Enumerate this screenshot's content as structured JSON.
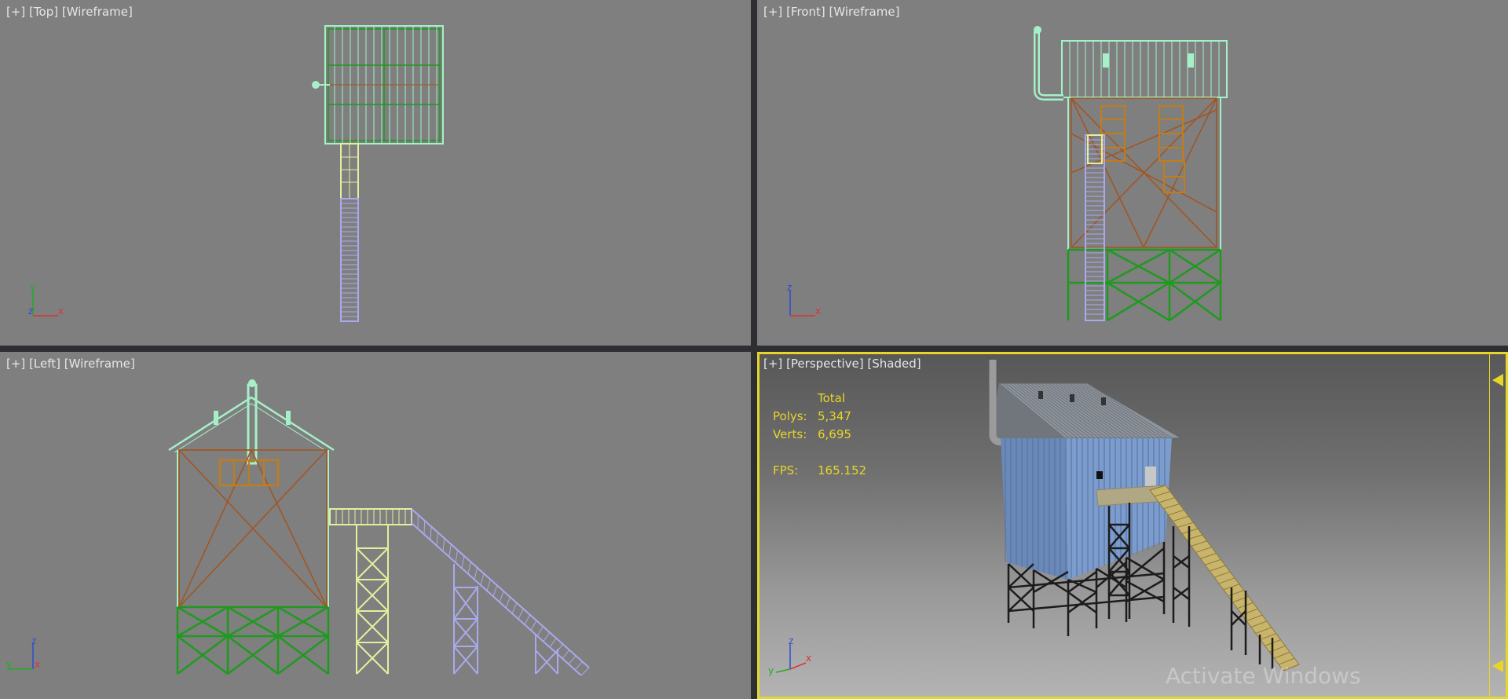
{
  "viewports": {
    "top": {
      "plus": "[+]",
      "view": "[Top]",
      "mode": "[Wireframe]"
    },
    "front": {
      "plus": "[+]",
      "view": "[Front]",
      "mode": "[Wireframe]"
    },
    "left": {
      "plus": "[+]",
      "view": "[Left]",
      "mode": "[Wireframe]"
    },
    "perspective": {
      "plus": "[+]",
      "view": "[Perspective]",
      "mode": "[Shaded]"
    }
  },
  "stats": {
    "header": "Total",
    "polys_label": "Polys:",
    "polys_value": "5,347",
    "verts_label": "Verts:",
    "verts_value": "6,695",
    "fps_label": "FPS:",
    "fps_value": "165.152"
  },
  "axes": {
    "top": {
      "up": "y",
      "left": "z",
      "right": "x"
    },
    "front": {
      "up": "z",
      "left": "y",
      "right": "x"
    },
    "left": {
      "up": "z",
      "left": "y",
      "right": "x"
    },
    "persp": {
      "up": "z",
      "left": "y",
      "right": "x"
    }
  },
  "watermark": "Activate Windows",
  "colors": {
    "active_border": "#e7d52a",
    "viewport_bg": "#7f7f7f",
    "frame_cyan": "#a6f0c8",
    "brace_orange": "#a3541d",
    "leg_green": "#1f9a1f",
    "stair_purple": "#a9a9ee",
    "tower_yellow": "#e4ef9e",
    "axis_x": "#e03030",
    "axis_y": "#27a927",
    "axis_z": "#2b4fd1"
  }
}
